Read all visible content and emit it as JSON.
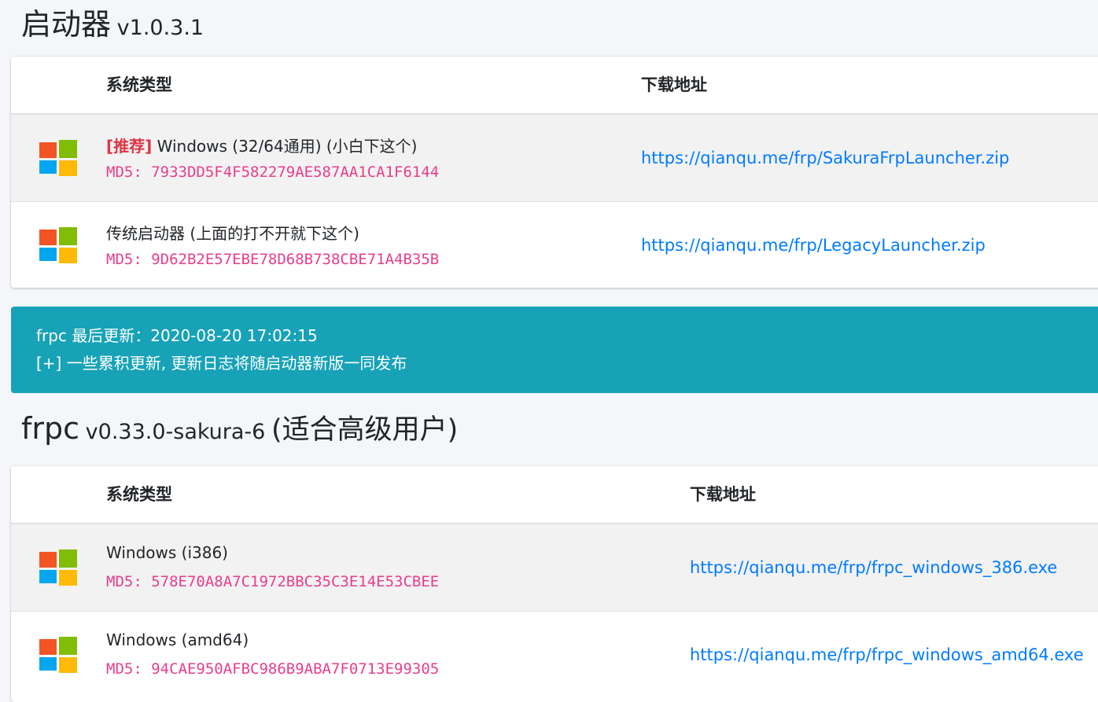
{
  "launcher": {
    "title": "启动器",
    "version": "v1.0.3.1",
    "headers": {
      "system": "系统类型",
      "download": "下载地址"
    },
    "rows": [
      {
        "tag": "[推荐]",
        "name": " Windows (32/64通用) (小白下这个)",
        "md5": "MD5: 7933DD5F4F582279AE587AA1CA1F6144",
        "url": "https://qianqu.me/frp/SakuraFrpLauncher.zip"
      },
      {
        "name": "传统启动器 (上面的打不开就下这个)",
        "md5": "MD5: 9D62B2E57EBE78D68B738CBE71A4B35B",
        "url": "https://qianqu.me/frp/LegacyLauncher.zip"
      }
    ]
  },
  "notice": {
    "line1": "frpc 最后更新：2020-08-20 17:02:15",
    "line2": "[+] 一些累积更新, 更新日志将随启动器新版一同发布",
    "color": "#17a2b8"
  },
  "frpc": {
    "title": "frpc",
    "version": "v0.33.0-sakura-6",
    "subtitle": "(适合高级用户)",
    "headers": {
      "system": "系统类型",
      "download": "下载地址"
    },
    "rows": [
      {
        "name": "Windows (i386)",
        "md5": "MD5: 578E70A8A7C1972BBC35C3E14E53CBEE",
        "url": "https://qianqu.me/frp/frpc_windows_386.exe"
      },
      {
        "name": "Windows (amd64)",
        "md5": "MD5: 94CAE950AFBC986B9ABA7F0713E99305",
        "url": "https://qianqu.me/frp/frpc_windows_amd64.exe"
      }
    ]
  },
  "icons": {
    "os": "windows-logo-icon"
  },
  "colors": {
    "link": "#007bff",
    "md5": "#e83e8c",
    "tag": "#dc3545"
  }
}
